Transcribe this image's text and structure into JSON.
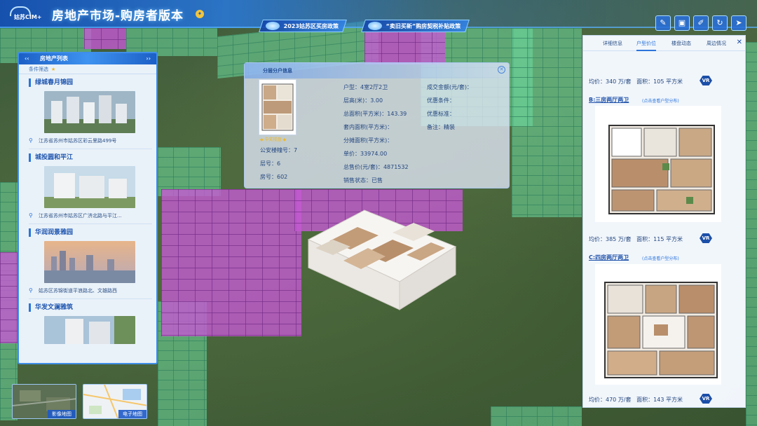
{
  "header": {
    "logo_text": "姑苏CIM+",
    "title": "房地产市场-购房者版本",
    "policies": [
      {
        "label": "2023姑苏区买房政策"
      },
      {
        "label": "“卖旧买新”购房契税补贴政策"
      }
    ],
    "tools": [
      {
        "icon": "ruler-icon",
        "glyph": "✎"
      },
      {
        "icon": "area-measure-icon",
        "glyph": "▣"
      },
      {
        "icon": "pen-icon",
        "glyph": "✐"
      },
      {
        "icon": "refresh-icon",
        "glyph": "↻"
      },
      {
        "icon": "pointer-icon",
        "glyph": "➤"
      }
    ]
  },
  "left_panel": {
    "title": "房地产列表",
    "filter_label": "条件筛选",
    "listings": [
      {
        "name": "绿城春月锦园",
        "address": "江苏省苏州市姑苏区彩云里路499号"
      },
      {
        "name": "城投圆和平江",
        "address": "江苏省苏州市姑苏区广济北路与平江..."
      },
      {
        "name": "华润润景雅园",
        "address": "姑苏区苏锦街道平浪路北、文雄路西"
      },
      {
        "name": "华发文澜雅筑",
        "address": ""
      }
    ]
  },
  "popup": {
    "title": "分层分户信息",
    "thumb_badge": "中奖楼盘",
    "col1": {
      "gongan_label": "公安楼幢号：",
      "gongan_value": "7",
      "floor_label": "层号：",
      "floor_value": "6",
      "room_label": "房号：",
      "room_value": "602"
    },
    "col2": {
      "layout_label": "户型：",
      "layout_value": "4室2厅2卫",
      "height_label": "层高(米)：",
      "height_value": "3.00",
      "gross_label": "总面积(平方米)：",
      "gross_value": "143.39",
      "inner_label": "套内面积(平方米)：",
      "inner_value": "",
      "shared_label": "分摊面积(平方米)：",
      "shared_value": "",
      "unit_price_label": "单价：",
      "unit_price_value": "33974.00",
      "total_label": "总售价(元/套)：",
      "total_value": "4871532",
      "status_label": "销售状态：",
      "status_value": "已售"
    },
    "col3": {
      "deal_label": "成交金额(元/套)：",
      "deal_value": "",
      "discount_label": "优惠条件：",
      "discount_value": "",
      "discount_std_label": "优惠标准：",
      "discount_std_value": "",
      "note_label": "备注：",
      "note_value": "精装"
    }
  },
  "right_panel": {
    "tabs": [
      "详细信息",
      "户型价位",
      "楼盘动态",
      "周边情况"
    ],
    "active_tab": "户型价位",
    "price_label": "均价：",
    "area_label": "面积：",
    "vr_label": "VR",
    "units": [
      {
        "title": "",
        "hint": "",
        "price": "340 万/套",
        "area": "105 平方米"
      },
      {
        "title": "B:三房两厅两卫",
        "hint": "(点击查看户型分布)",
        "price": "385 万/套",
        "area": "115 平方米"
      },
      {
        "title": "C:四房两厅两卫",
        "hint": "(点击查看户型分布)",
        "price": "470 万/套",
        "area": "143 平方米"
      }
    ]
  },
  "mini_maps": [
    {
      "label": "影像地图"
    },
    {
      "label": "电子地图"
    }
  ],
  "colors": {
    "accent": "#2b74dc",
    "header_blue": "#1c5fc6",
    "building_green": "#6edca0",
    "building_purple": "#c45ad2"
  }
}
